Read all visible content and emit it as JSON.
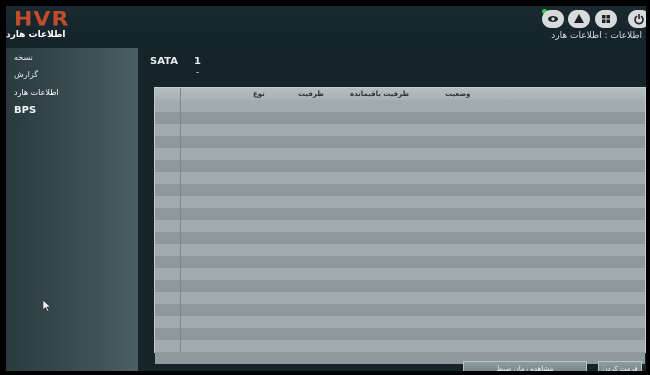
{
  "app": {
    "logo": "HVR"
  },
  "header": {
    "section_title": "اطلاعات هارد",
    "breadcrumb": "اطلاعات : اطلاعات هارد",
    "status_color": "#27d140",
    "icons": [
      "eye-icon",
      "alert-icon",
      "grid-icon",
      "power-icon"
    ]
  },
  "sidebar": {
    "items": [
      {
        "label": "نسخه"
      },
      {
        "label": "گزارش"
      },
      {
        "label": "اطلاعات هارد"
      },
      {
        "label": "BPS"
      }
    ]
  },
  "main": {
    "disk_label": "SATA",
    "disk_number": "1",
    "table": {
      "columns": [
        "نوع",
        "ظرفیت",
        "ظرفیت باقیمانده",
        "وضعیت"
      ],
      "rows": []
    }
  },
  "footer": {
    "view_record_time_button": "مشاهده زمان ضبط",
    "format_button": "فرمت کردن"
  }
}
